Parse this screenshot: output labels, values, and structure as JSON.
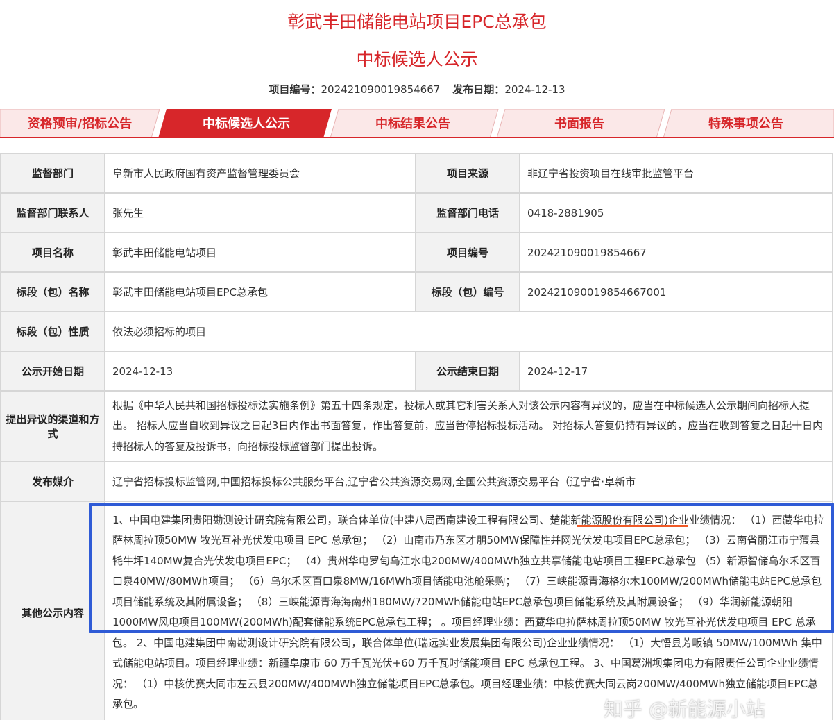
{
  "header": {
    "title_line1": "彰武丰田储能电站项目EPC总承包",
    "title_line2": "中标候选人公示",
    "project_no_label": "项目编号：",
    "project_no": "202421090019854667",
    "publish_date_label": "发布日期：",
    "publish_date": "2024-12-13"
  },
  "tabs": [
    {
      "label": "资格预审/招标公告",
      "active": false
    },
    {
      "label": "中标候选人公示",
      "active": true
    },
    {
      "label": "中标结果公告",
      "active": false
    },
    {
      "label": "书面报告",
      "active": false
    },
    {
      "label": "特殊事项公告",
      "active": false
    }
  ],
  "colors": {
    "accent": "#d7262a",
    "highlight_box": "#2f5bd6",
    "underline": "#f05a28"
  },
  "info": {
    "supervisor_dept_label": "监督部门",
    "supervisor_dept": "阜新市人民政府国有资产监督管理委员会",
    "project_source_label": "项目来源",
    "project_source": "非辽宁省投资项目在线审批监管平台",
    "contact_label": "监督部门联系人",
    "contact": "张先生",
    "phone_label": "监督部门电话",
    "phone": "0418-2881905",
    "project_name_label": "项目名称",
    "project_name": "彰武丰田储能电站项目",
    "project_no_label": "项目编号",
    "project_no": "202421090019854667",
    "section_name_label": "标段（包）名称",
    "section_name": "彰武丰田储能电站项目EPC总承包",
    "section_no_label": "标段（包）编号",
    "section_no": "202421090019854667001",
    "section_nature_label": "标段（包）性质",
    "section_nature": "依法必须招标的项目",
    "start_date_label": "公示开始日期",
    "start_date": "2024-12-13",
    "end_date_label": "公示结束日期",
    "end_date": "2024-12-17",
    "objection_label": "提出异议的渠道和方式",
    "objection": "根据《中华人民共和国招标投标法实施条例》第五十四条规定，投标人或其它利害关系人对该公示内容有异议的，应当在中标候选人公示期间向招标人提出。 招标人应当自收到异议之日起3日内作出书面答复，作出答复前，应当暂停招标投标活动。 对招标人答复仍持有异议的，应当在收到答复之日起十日内持招标人的答复及投诉书，向招标投标监督部门提出投诉。",
    "media_label": "发布媒介",
    "media": "辽宁省招标投标监管网,中国招标投标公共服务平台,辽宁省公共资源交易网,全国公共资源交易平台（辽宁省·阜新市",
    "other_label": "其他公示内容",
    "other": "1、中国电建集团贵阳勘测设计研究院有限公司，联合体单位(中建八局西南建设工程有限公司、楚能新能源股份有限公司)企业业绩情况： （1）西藏华电拉萨林周拉顶50MW 牧光互补光伏发电项目 EPC 总承包； （2）山南市乃东区才朋50MW保障性并网光伏发电项目EPC总承包； （3）云南省丽江市宁蒗县牦牛坪140MW复合光伏发电项目EPC； （4）贵州华电罗甸乌江水电200MW/400MWh独立共享储能电站项目工程EPC总承包 （5）新源智储乌尔禾区百口泉40MW/80MWh项目； （6）乌尔禾区百口泉8MW/16MWh项目储能电池舱采购； （7）三峡能源青海格尔木100MW/200MWh储能电站EPC总承包项目储能系统及其附属设备； （8）三峡能源青海海南州180MW/720MWh储能电站EPC总承包项目储能系统及其附属设备； （9）华润新能源朝阳1000MW风电项目100MW(200MWh)配套储能系统EPC总承包工程； 。项目经理业绩：西藏华电拉萨林周拉顶50MW 牧光互补光伏发电项目 EPC 总承包。 2、中国电建集团中南勘测设计研究院有限公司，联合体单位(瑞远实业发展集团有限公司)企业业绩情况： （1）大悟县芳畈镇 50MW/100MWh 集中式储能电站项目。项目经理业绩：新疆阜康市 60 万千瓦光伏+60 万千瓦时储能项目 EPC 总承包工程。 3、中国葛洲坝集团电力有限责任公司企业业绩情况： （1）中核优赛大同市左云县200MW/400MWh独立储能项目EPC总承包。项目经理业绩：中核优赛大同云岗200MW/400MWh独立储能项目EPC总承包。"
  },
  "watermark": "知乎 @新能源小站"
}
